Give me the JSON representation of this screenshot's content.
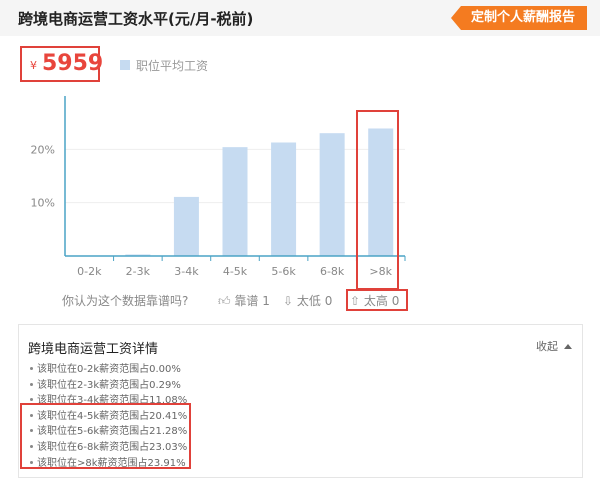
{
  "header": {
    "title": "跨境电商运营工资水平(元/月-税前)",
    "report_button": "定制个人薪酬报告"
  },
  "salary": {
    "currency_symbol": "¥",
    "value": "5959"
  },
  "legend": {
    "label": "职位平均工资"
  },
  "feedback": {
    "question": "你认为这个数据靠谱吗?",
    "votes": [
      {
        "icon": "thumbs-up-icon",
        "label": "靠谱",
        "count": "1"
      },
      {
        "icon": "arrow-down-icon",
        "label": "太低",
        "count": "0"
      },
      {
        "icon": "arrow-up-icon",
        "label": "太高",
        "count": "0"
      }
    ]
  },
  "details": {
    "title": "跨境电商运营工资详情",
    "collapse_label": "收起",
    "items": [
      "该职位在0-2k薪资范围占0.00%",
      "该职位在2-3k薪资范围占0.29%",
      "该职位在3-4k薪资范围占11.08%",
      "该职位在4-5k薪资范围占20.41%",
      "该职位在5-6k薪资范围占21.28%",
      "该职位在6-8k薪资范围占23.03%",
      "该职位在>8k薪资范围占23.91%"
    ]
  },
  "colors": {
    "accent": "#f47b20",
    "bar": "#c6dbf1",
    "highlight": "#e0413a",
    "axis": "#4aa3c5",
    "price": "#e8453c"
  },
  "chart_data": {
    "type": "bar",
    "categories": [
      "0-2k",
      "2-3k",
      "3-4k",
      "4-5k",
      "5-6k",
      "6-8k",
      ">8k"
    ],
    "values": [
      0.0,
      0.29,
      11.08,
      20.41,
      21.28,
      23.03,
      23.91
    ],
    "ylim": [
      0,
      30
    ],
    "yticks": [
      10,
      20
    ],
    "ytick_labels": [
      "10%",
      "20%"
    ],
    "grid": true,
    "legend_position": "top-left"
  }
}
